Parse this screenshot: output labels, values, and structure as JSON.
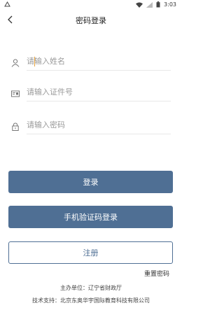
{
  "status_bar": {
    "left_icon": "notification-icon",
    "time": "3:03"
  },
  "header": {
    "title": "密码登录",
    "back_icon": "back-arrow-icon"
  },
  "form": {
    "name": {
      "icon": "user-icon",
      "placeholder": "请输入姓名"
    },
    "id_number": {
      "icon": "id-card-icon",
      "placeholder": "请输入证件号"
    },
    "password": {
      "icon": "lock-icon",
      "placeholder": "请输入密码"
    }
  },
  "buttons": {
    "login": "登录",
    "sms_login": "手机验证码登录",
    "register": "注册"
  },
  "links": {
    "reset_password": "重置密码"
  },
  "footer": {
    "sponsor": "主办单位：辽宁省财政厅",
    "tech_support": "技术支持：北京东奥华宇国际教育科技有限公司"
  },
  "colors": {
    "primary": "#4f6f94",
    "caret": "#e8a23a"
  }
}
